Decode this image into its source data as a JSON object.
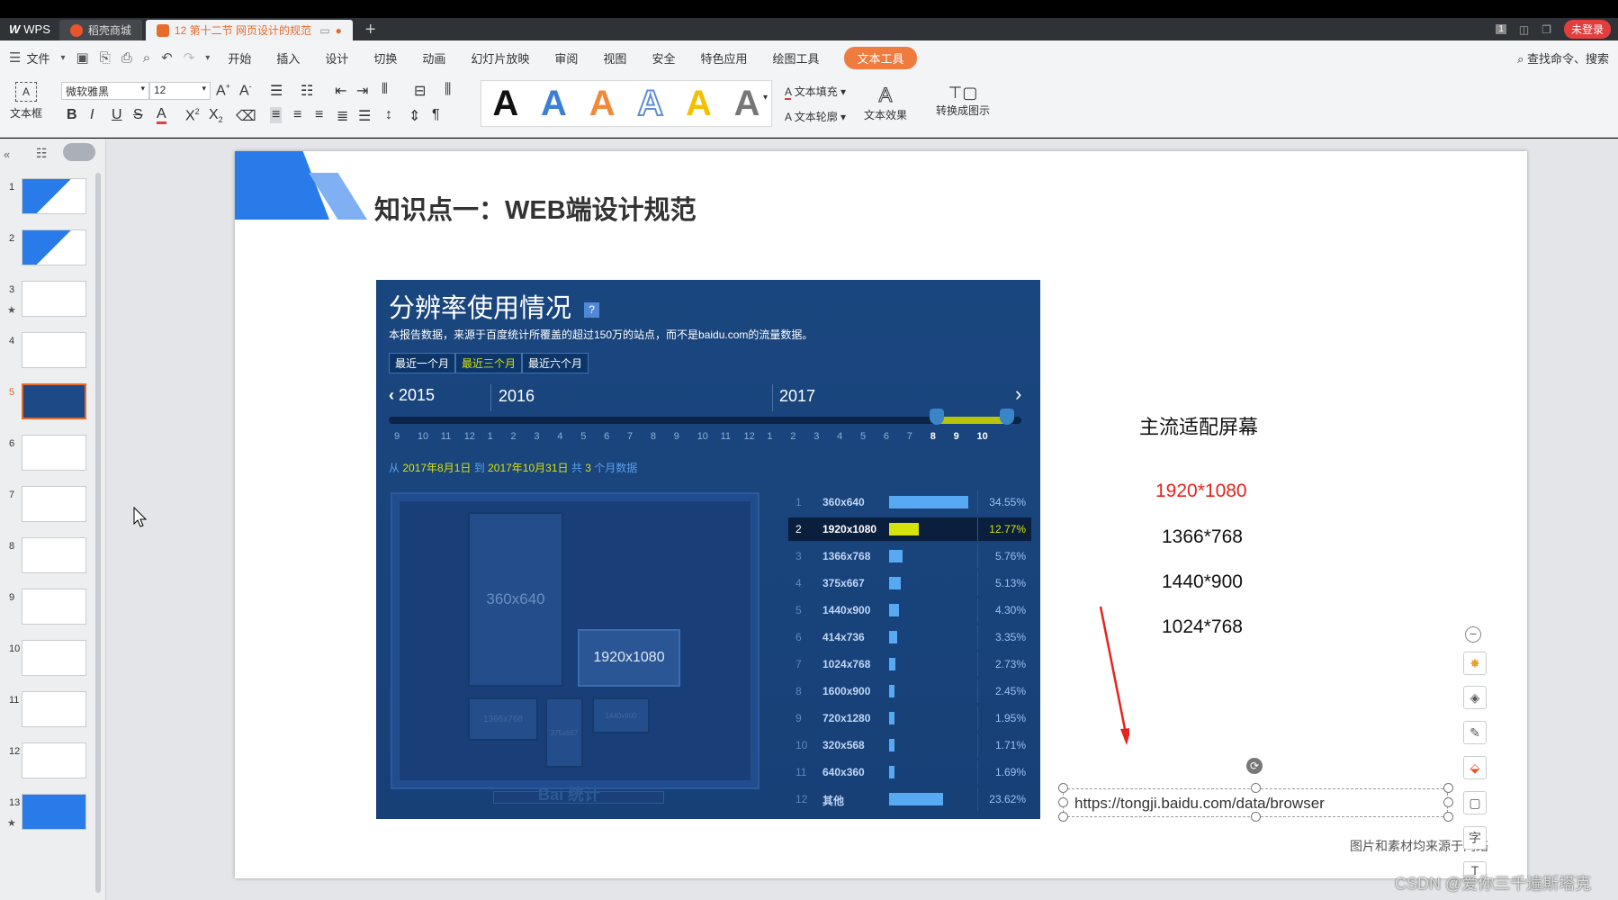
{
  "tabs": {
    "app": "WPS",
    "store": "稻壳商城",
    "doc": "12 第十二节 网页设计的规范"
  },
  "login": "未登录",
  "menu": {
    "file": "文件",
    "items": [
      "开始",
      "插入",
      "设计",
      "切换",
      "动画",
      "幻灯片放映",
      "审阅",
      "视图",
      "安全",
      "特色应用",
      "绘图工具"
    ],
    "active": "文本工具",
    "search": "查找命令、搜索"
  },
  "ribbon": {
    "textbox": "文本框",
    "font": "微软雅黑",
    "size": "12",
    "fill": "文本填充",
    "outline": "文本轮廓",
    "effect": "文本效果",
    "convert": "转换成图示",
    "art_letter": "A"
  },
  "slide_numbers": [
    "1",
    "2",
    "3",
    "4",
    "5",
    "6",
    "7",
    "8",
    "9",
    "10",
    "11",
    "12",
    "13"
  ],
  "slide": {
    "title": "知识点一：WEB端设计规范",
    "panel": {
      "title": "分辨率使用情况",
      "help": "?",
      "desc": "本报告数据，来源于百度统计所覆盖的超过150万的站点，而不是baidu.com的流量数据。",
      "periods": [
        "最近一个月",
        "最近三个月",
        "最近六个月"
      ],
      "years": [
        "2015",
        "2016",
        "2017"
      ],
      "months": [
        "9",
        "10",
        "11",
        "12",
        "1",
        "2",
        "3",
        "4",
        "5",
        "6",
        "7",
        "8",
        "9",
        "10",
        "11",
        "12",
        "1",
        "2",
        "3",
        "4",
        "5",
        "6",
        "7",
        "8",
        "9",
        "10"
      ],
      "range": {
        "from": "从",
        "d1": "2017年8月1日",
        "to": "到",
        "d2": "2017年10月31日",
        "total": "共",
        "n": "3",
        "unit": "个月数据"
      },
      "boxes": [
        "360x640",
        "1920x1080",
        "1366x768",
        "375x667",
        "1440x900"
      ],
      "logo": "Bai 统计",
      "rows": [
        {
          "rank": "1",
          "res": "360x640",
          "pct": "34.55%",
          "v": 34.55
        },
        {
          "rank": "2",
          "res": "1920x1080",
          "pct": "12.77%",
          "v": 12.77
        },
        {
          "rank": "3",
          "res": "1366x768",
          "pct": "5.76%",
          "v": 5.76
        },
        {
          "rank": "4",
          "res": "375x667",
          "pct": "5.13%",
          "v": 5.13
        },
        {
          "rank": "5",
          "res": "1440x900",
          "pct": "4.30%",
          "v": 4.3
        },
        {
          "rank": "6",
          "res": "414x736",
          "pct": "3.35%",
          "v": 3.35
        },
        {
          "rank": "7",
          "res": "1024x768",
          "pct": "2.73%",
          "v": 2.73
        },
        {
          "rank": "8",
          "res": "1600x900",
          "pct": "2.45%",
          "v": 2.45
        },
        {
          "rank": "9",
          "res": "720x1280",
          "pct": "1.95%",
          "v": 1.95
        },
        {
          "rank": "10",
          "res": "320x568",
          "pct": "1.71%",
          "v": 1.71
        },
        {
          "rank": "11",
          "res": "640x360",
          "pct": "1.69%",
          "v": 1.69
        },
        {
          "rank": "12",
          "res": "其他",
          "pct": "23.62%",
          "v": 23.62
        }
      ]
    },
    "screens_title": "主流适配屏幕",
    "screens": [
      "1920*1080",
      "1366*768",
      "1440*900",
      "1024*768"
    ],
    "url": "https://tongji.baidu.com/data/browser",
    "source": "图片和素材均来源于网络"
  },
  "watermark": "CSDN @爱你三千遍斯塔克",
  "colors": {
    "accent": "#f07b3f",
    "panel": "#163e7a",
    "highlight": "#d6e30a",
    "red": "#e8221c"
  }
}
